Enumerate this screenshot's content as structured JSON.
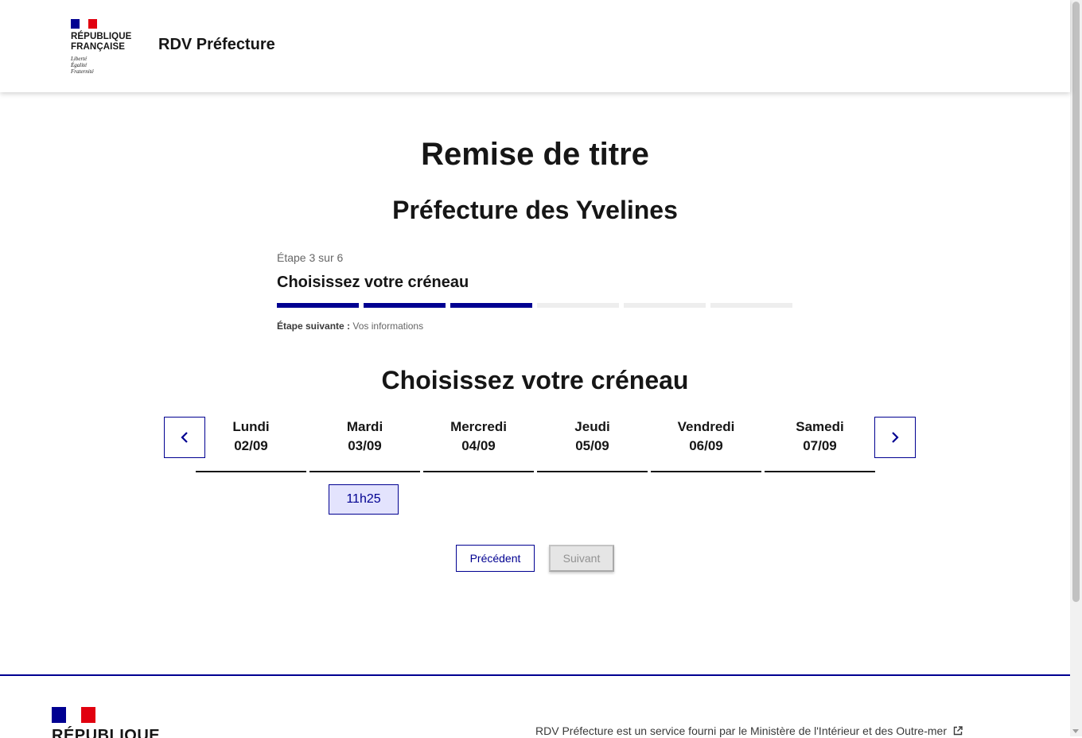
{
  "header": {
    "logo_line1": "RÉPUBLIQUE",
    "logo_line2": "FRANÇAISE",
    "motto": [
      "Liberté",
      "Égalité",
      "Fraternité"
    ],
    "service_name": "RDV Préfecture"
  },
  "page": {
    "title": "Remise de titre",
    "subtitle": "Préfecture des Yvelines"
  },
  "stepper": {
    "state": "Étape 3 sur 6",
    "current_title": "Choisissez votre créneau",
    "current_step": 3,
    "total_steps": 6,
    "next_label": "Étape suivante :",
    "next_value": "Vos informations"
  },
  "slots": {
    "title": "Choisissez votre créneau",
    "days": [
      {
        "name": "Lundi",
        "date": "02/09"
      },
      {
        "name": "Mardi",
        "date": "03/09"
      },
      {
        "name": "Mercredi",
        "date": "04/09"
      },
      {
        "name": "Jeudi",
        "date": "05/09"
      },
      {
        "name": "Vendredi",
        "date": "06/09"
      },
      {
        "name": "Samedi",
        "date": "07/09"
      }
    ],
    "available_slot": "11h25"
  },
  "actions": {
    "previous": "Précédent",
    "next": "Suivant"
  },
  "footer": {
    "logo_text": "RÉPUBLIQUE",
    "description": "RDV Préfecture est un service fourni par le Ministère de l'Intérieur et des Outre-mer"
  },
  "colors": {
    "primary": "#000091",
    "flag_red": "#e1000f",
    "slot_bg": "#e3e3fd",
    "disabled_bg": "#e5e5e5"
  },
  "icons": [
    "chevron-left-icon",
    "chevron-right-icon",
    "external-link-icon",
    "marianne-icon"
  ]
}
